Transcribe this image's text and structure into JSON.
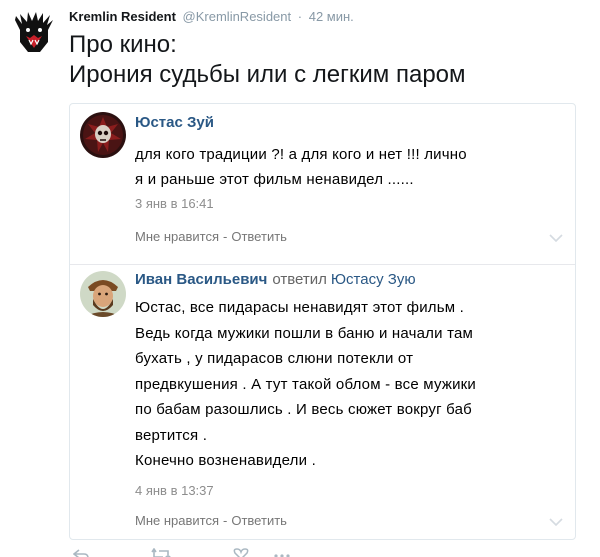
{
  "tweet": {
    "author_name": "Kremlin Resident",
    "author_handle": "@KremlinResident",
    "separator": "·",
    "time": "42 мин.",
    "text_line1": "Про кино:",
    "text_line2": "Ирония судьбы или с легким паром"
  },
  "embedded": {
    "comments": [
      {
        "author": "Юстас Зуй",
        "text_lines": [
          "для кого традиции ?! а для кого и нет !!! лично",
          "я и раньше этот фильм ненавидел ......"
        ],
        "date": "3 янв в 16:41",
        "like_label": "Мне нравится",
        "dash": "-",
        "reply_label": "Ответить"
      },
      {
        "author": "Иван Васильевич",
        "reply_prefix": "ответил",
        "reply_to": "Юстасу Зую",
        "text_lines": [
          "Юстас, все пидарасы ненавидят этот фильм .",
          "Ведь когда мужики пошли в баню и начали там",
          "бухать , у пидарасов слюни потекли от",
          "предвкушения . А тут такой облом - все мужики",
          "по бабам разошлись . И весь сюжет вокруг баб",
          "вертится .",
          "Конечно возненавидели ."
        ],
        "date": "4 янв в 13:37",
        "like_label": "Мне нравится",
        "dash": "-",
        "reply_label": "Ответить"
      }
    ]
  },
  "icons": {
    "main_avatar": "bear-logo-icon",
    "reply": "reply-icon",
    "retweet": "retweet-icon",
    "like": "heart-icon",
    "more": "more-icon",
    "chevron": "chevron-down-icon"
  },
  "colors": {
    "vk_link": "#2a5885",
    "meta_gray": "#8899a6",
    "text": "#14171a"
  }
}
